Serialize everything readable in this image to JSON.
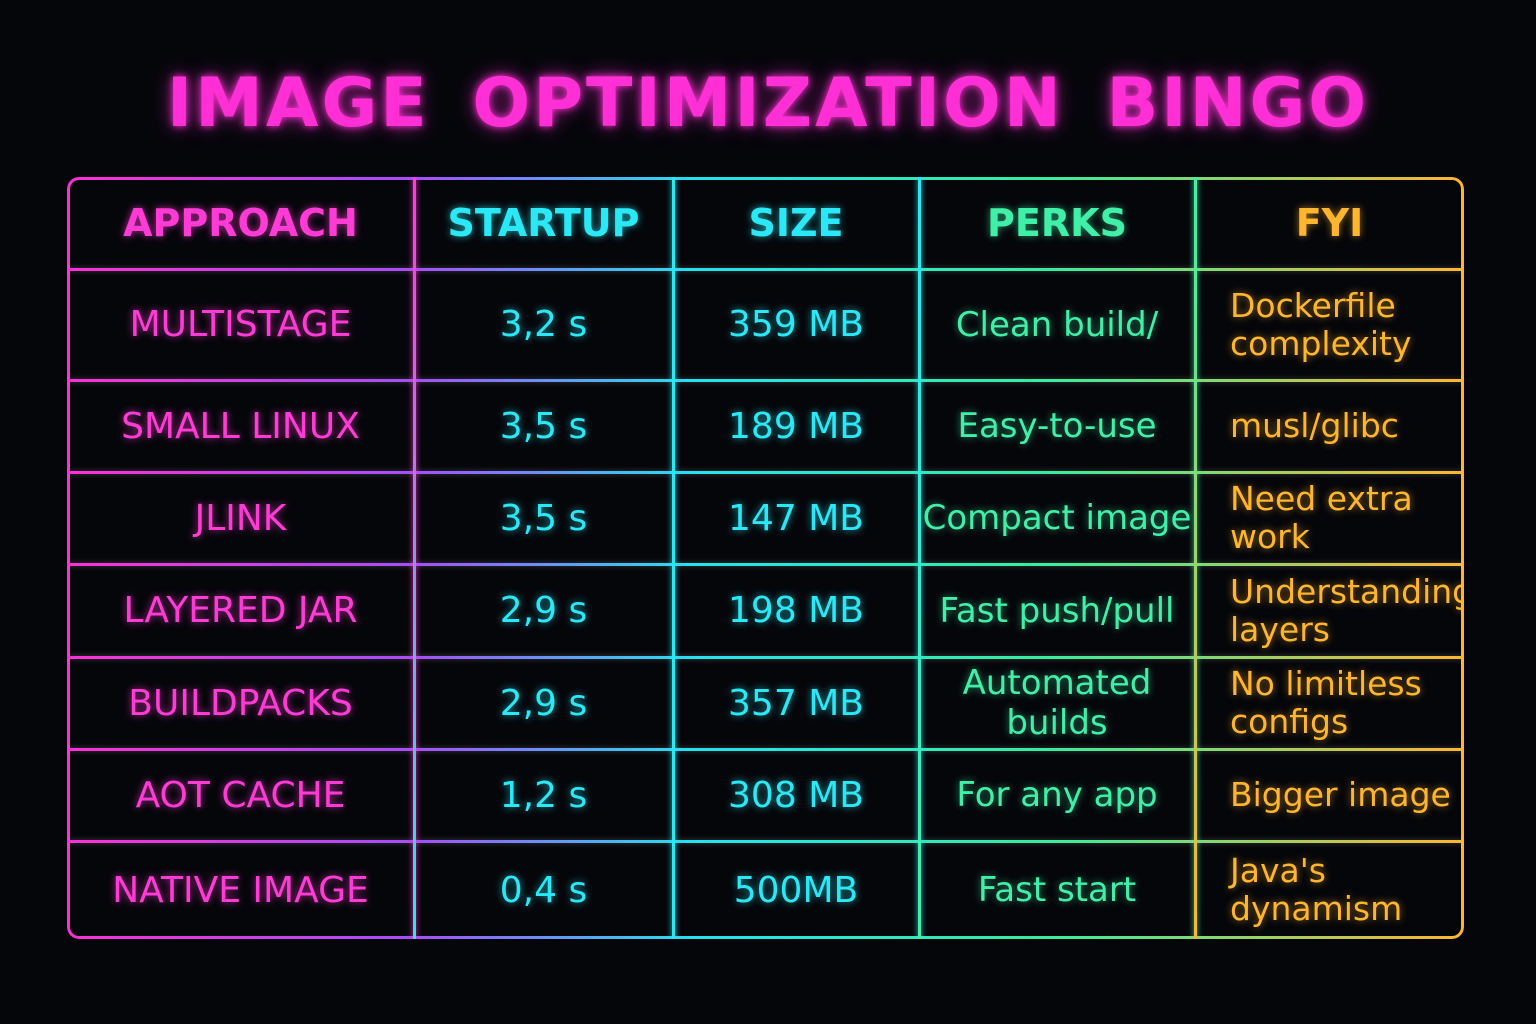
{
  "title": "IMAGE OPTIMIZATION BINGO",
  "colors": {
    "approach": "#ff3bd6",
    "startup": "#2ae8f5",
    "size": "#2ae8f5",
    "perks": "#40f0a8",
    "fyi": "#ffb52e",
    "background": "#05060a"
  },
  "table": {
    "headers": [
      "APPROACH",
      "STARTUP",
      "SIZE",
      "PERKS",
      "FYI"
    ],
    "rows": [
      [
        "MULTISTAGE",
        "3,2 s",
        "359 MB",
        "Clean build/",
        "Dockerfile complexity"
      ],
      [
        "SMALL LINUX",
        "3,5 s",
        "189 MB",
        "Easy-to-use",
        "musl/glibc"
      ],
      [
        "JLINK",
        "3,5 s",
        "147 MB",
        "Compact image",
        "Need extra work"
      ],
      [
        "LAYERED JAR",
        "2,9 s",
        "198 MB",
        "Fast push/pull",
        "Understanding layers"
      ],
      [
        "BUILDPACKS",
        "2,9 s",
        "357 MB",
        "Automated builds",
        "No limitless configs"
      ],
      [
        "AOT CACHE",
        "1,2 s",
        "308 MB",
        "For any app",
        "Bigger image"
      ],
      [
        "NATIVE IMAGE",
        "0,4 s",
        "500MB",
        "Fast start",
        "Java's dynamism"
      ]
    ]
  }
}
